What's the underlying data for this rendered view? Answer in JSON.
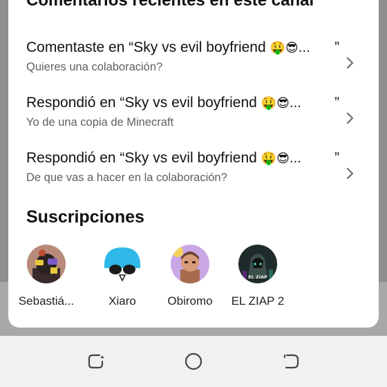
{
  "recent_comments": {
    "title": "Comentarios recientes en este canal",
    "items": [
      {
        "title": "Comentaste en “Sky vs evil boyfriend",
        "emoji": "🤑😎...",
        "quote": "”",
        "text": "Quieres una colaboración?"
      },
      {
        "title": "Respondió en “Sky vs evil boyfriend",
        "emoji": "🤑😎...",
        "quote": "”",
        "text": "Yo de una copia de Minecraft"
      },
      {
        "title": "Respondió en “Sky vs evil boyfriend",
        "emoji": "🤑😎...",
        "quote": "”",
        "text": "De que vas a hacer en la colaboración?"
      }
    ]
  },
  "subscriptions": {
    "title": "Suscripciones",
    "items": [
      {
        "name": "Sebastiá..."
      },
      {
        "name": "Xiaro"
      },
      {
        "name": "Obiromo"
      },
      {
        "name": "EL ZIAP 2",
        "avatar_text": "EL ZIAP"
      }
    ]
  },
  "navbar": {
    "buttons": [
      "recent-apps",
      "home",
      "back"
    ]
  },
  "colors": {
    "sheet": "#ffffff",
    "text": "#111111",
    "secondary_text": "#5f5f5f",
    "navbar": "#f1f1f1"
  }
}
